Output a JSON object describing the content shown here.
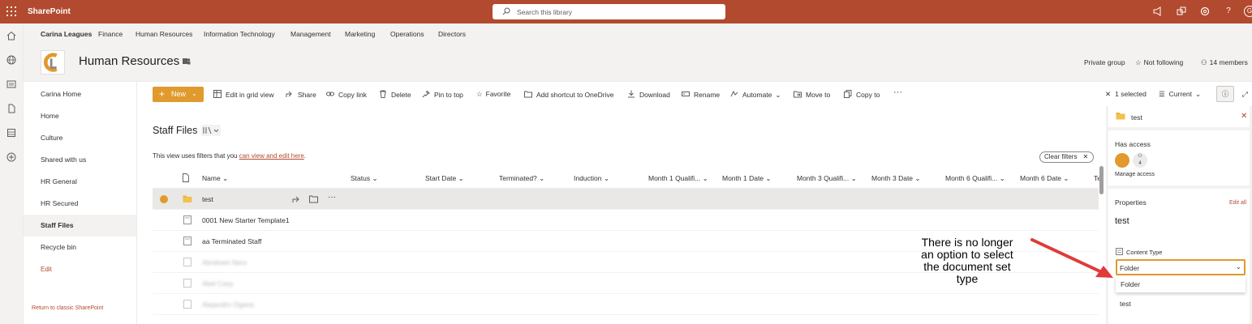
{
  "suite": {
    "app_name": "SharePoint",
    "search_placeholder": "Search this library",
    "icons": [
      "megaphone-icon",
      "share-icon",
      "gear-icon",
      "help-icon",
      "avatar-icon"
    ],
    "avatar_initial": "G",
    "accent": "#b14a2e"
  },
  "hubnav": {
    "hub_name": "Carina Leagues",
    "links": [
      "Finance",
      "Human Resources",
      "Information Technology",
      "Management",
      "Marketing",
      "Operations",
      "Directors"
    ]
  },
  "site": {
    "title": "Human Resources",
    "privacy": "Private group",
    "follow": "Not following",
    "members": "14 members"
  },
  "leftnav": {
    "items": [
      "Carina Home",
      "Home",
      "Culture",
      "Shared with us",
      "HR General",
      "HR Secured",
      "Staff Files",
      "Recycle bin",
      "Edit"
    ],
    "selected": "Staff Files",
    "return_link": "Return to classic SharePoint"
  },
  "commandbar": {
    "new": "New",
    "commands": [
      "Edit in grid view",
      "Share",
      "Copy link",
      "Delete",
      "Pin to top",
      "Favorite",
      "Add shortcut to OneDrive",
      "Download",
      "Rename",
      "Automate",
      "Move to",
      "Copy to"
    ],
    "more": "···",
    "selected_count": "1 selected",
    "view": "Current",
    "button_color": "#e19a2d"
  },
  "library": {
    "title": "Staff Files",
    "filter_msg_prefix": "This view uses filters that you ",
    "filter_msg_link": "can view and edit here",
    "filter_msg_suffix": ".",
    "clear_filters": "Clear filters",
    "columns": [
      "Name",
      "Status",
      "Start Date",
      "Terminated?",
      "Induction",
      "Month 1 Qualifi...",
      "Month 1 Date",
      "Month 3 Qualifi...",
      "Month 3 Date",
      "Month 6 Qualifi...",
      "Month 6 Date",
      "Te"
    ],
    "rows": [
      {
        "name": "test",
        "type": "folder",
        "selected": true
      },
      {
        "name": "0001 New Starter Template1",
        "type": "docset",
        "selected": false
      },
      {
        "name": "aa Terminated Staff",
        "type": "docset",
        "selected": false
      },
      {
        "name": "Abraham Nero",
        "type": "docset",
        "selected": false,
        "blurred": true
      },
      {
        "name": "Abel Casy",
        "type": "docset",
        "selected": false,
        "blurred": true
      },
      {
        "name": "Alejandro Ogana",
        "type": "docset",
        "selected": false,
        "blurred": true
      }
    ]
  },
  "details": {
    "item_name": "test",
    "has_access": "Has access",
    "access_count": "4",
    "manage_access": "Manage access",
    "properties": "Properties",
    "edit_all": "Edit all",
    "name_value": "test",
    "content_type_label": "Content Type",
    "content_type_value": "Folder",
    "dropdown_option": "Folder",
    "next_value": "test"
  },
  "annotation": {
    "lines": [
      "There is no longer",
      "an option to select",
      "the document set",
      "type"
    ],
    "arrow_color": "#e03a3a"
  }
}
